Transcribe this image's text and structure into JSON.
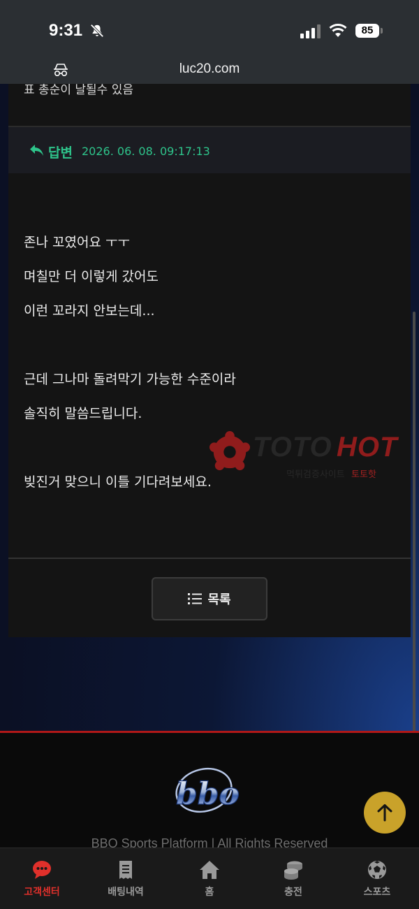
{
  "status_bar": {
    "time": "9:31",
    "battery": "85",
    "url": "luc20.com",
    "icons": [
      "bell-off-icon",
      "signal-icon",
      "wifi-icon",
      "battery-icon",
      "incognito-icon"
    ]
  },
  "post": {
    "cut_off_text": "표 총순이 날될수 있음",
    "answer_label": "답변",
    "answer_date": "2026. 06. 08. 09:17:13",
    "body_lines": [
      "존나 꼬였어요 ㅜㅜ",
      "며칠만 더 이렇게 갔어도",
      "이런 꼬라지 안보는데...",
      "근데 그나마 돌려막기 가능한 수준이라",
      "솔직히 말씀드립니다.",
      "빚진거 맞으니 이틀 기다려보세요."
    ],
    "list_button_label": "목록"
  },
  "watermark": {
    "brand_part1": "TOTO",
    "brand_part2": "HOT",
    "sub_part1": "먹튀검증사이트",
    "sub_part2": "토토핫"
  },
  "footer": {
    "logo_text": "bbo",
    "copyright": "BBO Sports Platform | All Rights Reserved"
  },
  "bottom_nav": {
    "items": [
      {
        "label": "고객센터",
        "icon": "chat-bubble-icon",
        "active": true
      },
      {
        "label": "배팅내역",
        "icon": "receipt-icon",
        "active": false
      },
      {
        "label": "홈",
        "icon": "home-icon",
        "active": false
      },
      {
        "label": "충전",
        "icon": "coins-icon",
        "active": false
      },
      {
        "label": "스포츠",
        "icon": "soccer-ball-icon",
        "active": false
      }
    ]
  },
  "colors": {
    "accent_green": "#2ec48b",
    "active_red": "#e0302b",
    "scroll_top_gold": "#c9a22a",
    "footer_red_line": "#b01818"
  }
}
